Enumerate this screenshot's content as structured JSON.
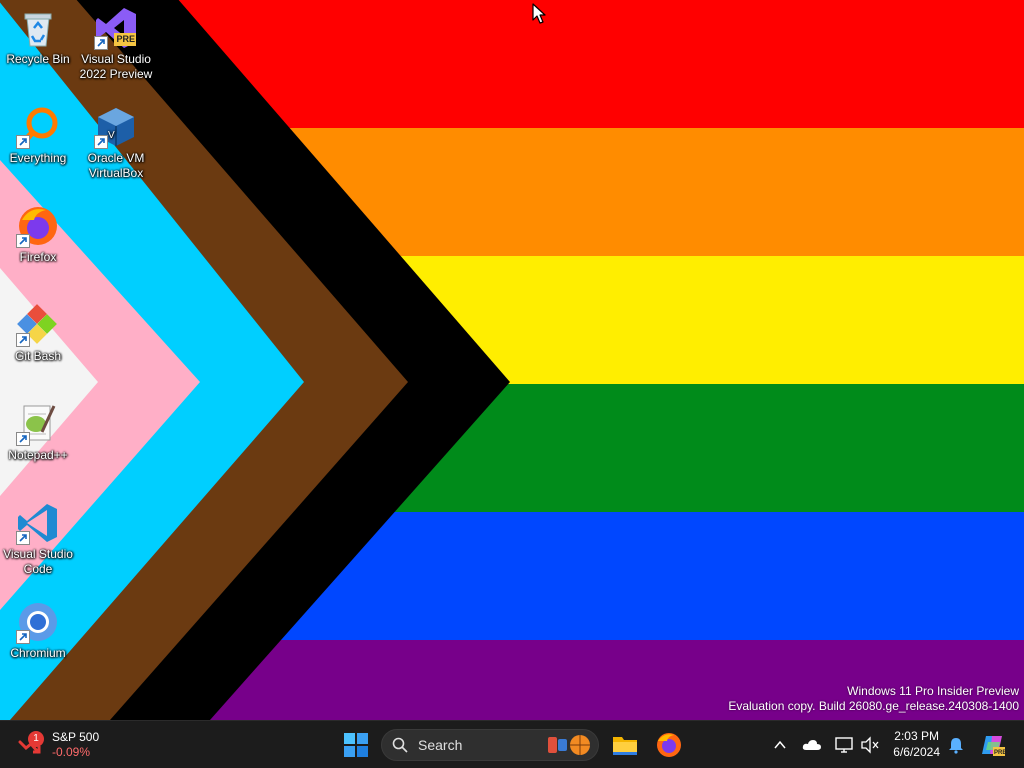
{
  "desktop": {
    "icons": [
      {
        "name": "recycle-bin",
        "label": "Recycle Bin"
      },
      {
        "name": "visual-studio-2022-preview",
        "label": "Visual Studio 2022 Preview",
        "badge": "PRE"
      },
      {
        "name": "everything",
        "label": "Everything"
      },
      {
        "name": "oracle-vm-virtualbox",
        "label": "Oracle VM VirtualBox"
      },
      {
        "name": "firefox",
        "label": "Firefox"
      },
      {
        "name": "git-bash",
        "label": "Git Bash"
      },
      {
        "name": "notepad-plus-plus",
        "label": "Notepad++"
      },
      {
        "name": "visual-studio-code",
        "label": "Visual Studio Code"
      },
      {
        "name": "chromium",
        "label": "Chromium"
      }
    ]
  },
  "watermark": {
    "line1": "Windows 11 Pro Insider Preview",
    "line2": "Evaluation copy. Build 26080.ge_release.240308-1400"
  },
  "taskbar": {
    "widget": {
      "title": "S&P 500",
      "change": "-0.09%",
      "badge": "1"
    },
    "search": {
      "label": "Search"
    },
    "pinned": [
      "start-button",
      "file-explorer",
      "firefox"
    ],
    "clock": {
      "time": "2:03 PM",
      "date": "6/6/2024"
    },
    "tray_icons": [
      "chevron-up-icon",
      "onedrive-icon",
      "network-icon",
      "volume-muted-icon",
      "notification-bell-icon",
      "copilot-icon"
    ]
  },
  "colors": {
    "red": "#ff0000",
    "orange": "#ff8c00",
    "yellow": "#ffee00",
    "green": "#008b1a",
    "blue": "#0047ff",
    "purple": "#77008a",
    "black": "#000000",
    "brown": "#6b3a11",
    "light_blue": "#00cfff",
    "pink": "#ffafc7",
    "white": "#f4f4f4",
    "taskbar": "#1c1c1c"
  }
}
